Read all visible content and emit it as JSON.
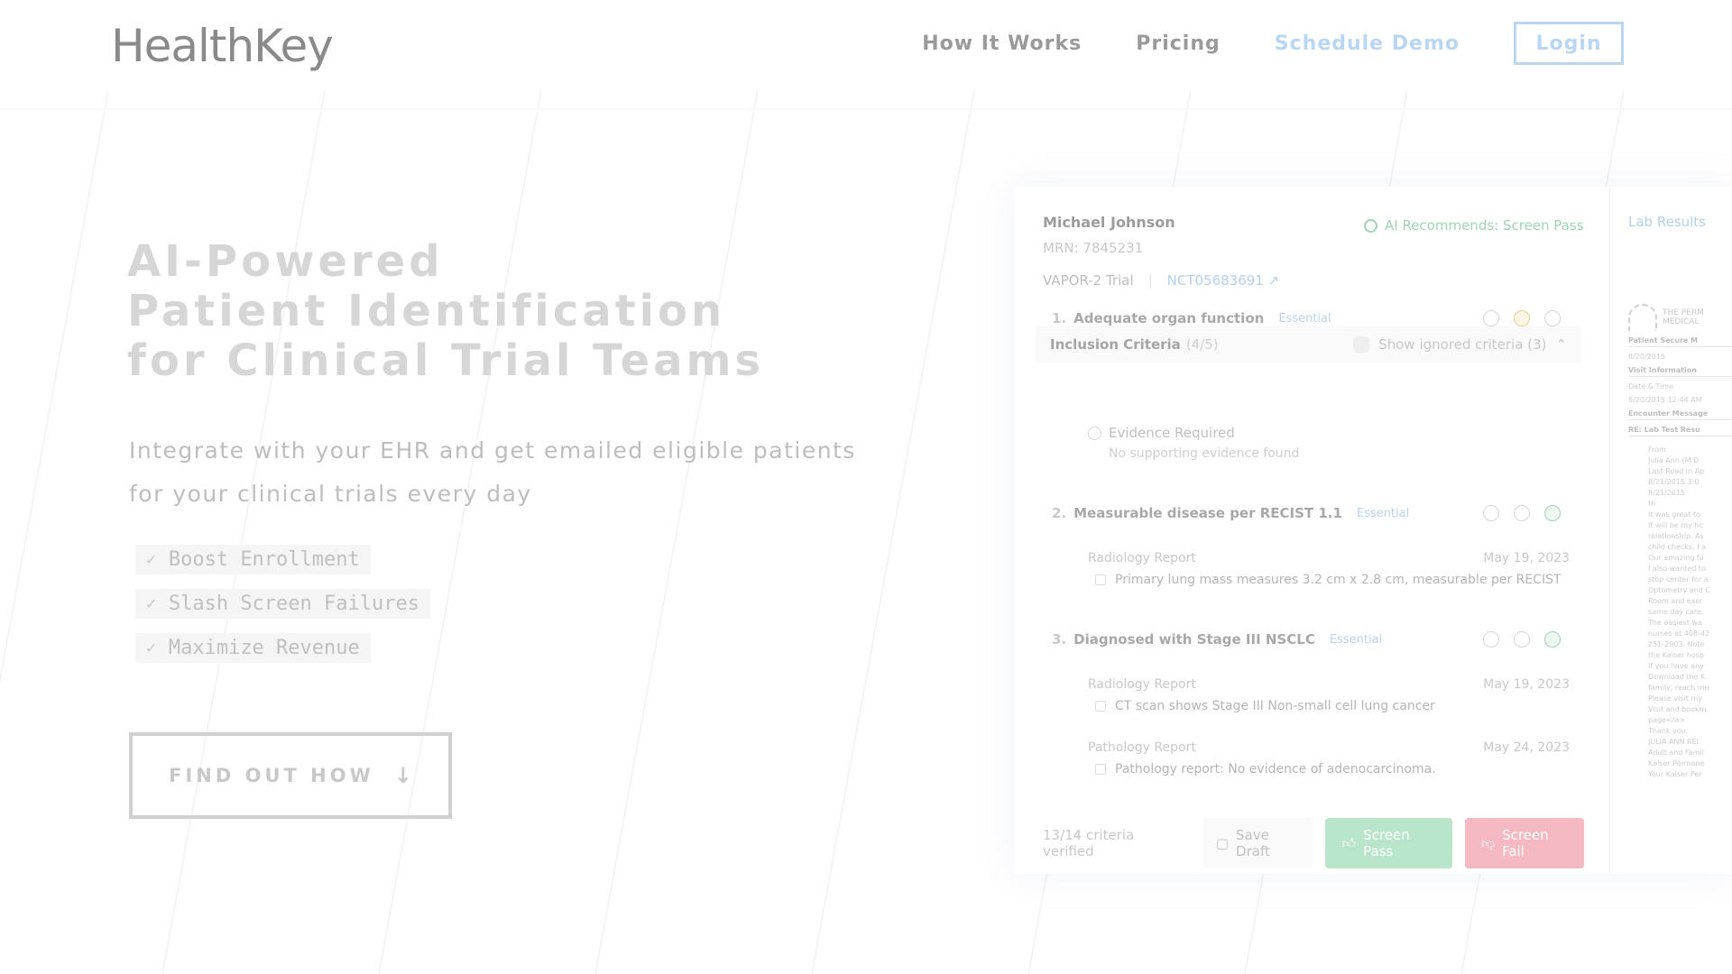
{
  "nav": {
    "logo": "HealthKey",
    "links": [
      "How It Works",
      "Pricing",
      "Schedule Demo"
    ],
    "login": "Login"
  },
  "hero": {
    "title_lines": [
      "AI-Powered",
      "Patient Identification",
      "for Clinical Trial Teams"
    ],
    "subtitle": "Integrate with your EHR and get emailed eligible patients for your clinical trials every day",
    "benefits": [
      "Boost Enrollment",
      "Slash Screen Failures",
      "Maximize Revenue"
    ],
    "cta": "FIND OUT HOW"
  },
  "card": {
    "patient_name": "Michael Johnson",
    "mrn": "MRN: 7845231",
    "ai_recommendation": "AI Recommends: Screen Pass",
    "side_tab": "Lab Results",
    "trial_name": "VAPOR-2 Trial",
    "trial_id": "NCT05683691",
    "inclusion_title": "Inclusion Criteria",
    "inclusion_count": "(4/5)",
    "show_ignored": "Show ignored criteria (3)",
    "criteria": [
      {
        "num": "1.",
        "title": "Adequate organ function",
        "tag": "Essential",
        "evidence_title": "Evidence Required",
        "evidence_sub": "No supporting evidence found"
      },
      {
        "num": "2.",
        "title": "Measurable disease per RECIST 1.1",
        "tag": "Essential",
        "docs": [
          {
            "type": "Radiology Report",
            "date": "May 19, 2023",
            "text": "Primary lung mass measures 3.2 cm x 2.8 cm, measurable per RECIST"
          }
        ]
      },
      {
        "num": "3.",
        "title": "Diagnosed with Stage III NSCLC",
        "tag": "Essential",
        "docs": [
          {
            "type": "Radiology Report",
            "date": "May 19, 2023",
            "text": "CT scan shows Stage III Non-small cell lung cancer"
          },
          {
            "type": "Pathology Report",
            "date": "May 24, 2023",
            "text": "Pathology report: No evidence of adenocarcinoma."
          }
        ]
      }
    ],
    "verified": "13/14 criteria verified",
    "save_draft": "Save Draft",
    "screen_pass": "Screen Pass",
    "screen_fail": "Screen Fail",
    "side_doc": {
      "org": "THE PERM MEDICAL",
      "lines": [
        "Patient Secure M",
        "8/20/2015",
        "Visit Information",
        "Date & Time",
        "8/20/2015 12:44 AM",
        "Encounter Message",
        "RE: Lab Test Resu",
        "From",
        "Julia Ann (M.D",
        "Last Read in Ap",
        "8/21/2015 3:0",
        "8/21/2015",
        "Hi",
        "It was great to",
        "It will be my hc",
        "relationship. As",
        "child checks. I a",
        "Our amazing fu",
        "I also wanted to",
        "stop center for a",
        "Optometry and C",
        "Room and exer",
        "same day care.",
        "The easiest wa",
        "nurses at 408-42",
        "251-2903. Note",
        "the Kaiser hosp",
        "If you have any",
        "Download the K",
        "family, reach me",
        "Please visit my",
        "Visit and bookm",
        "page</a>",
        "Thank you,",
        "JULIA ANN REI",
        "Adult and Famil",
        "Kaiser Permane",
        "Your Kaiser Per"
      ]
    }
  }
}
